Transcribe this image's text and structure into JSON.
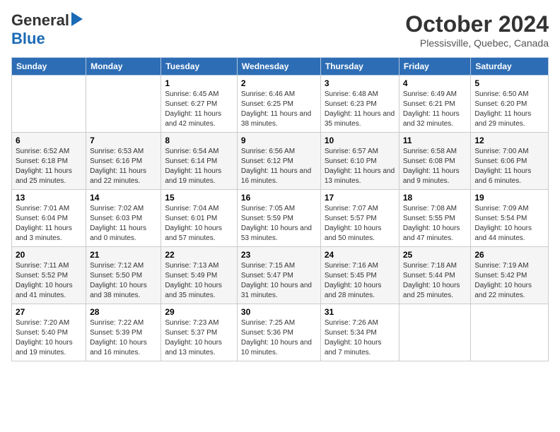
{
  "header": {
    "logo_line1": "General",
    "logo_line2": "Blue",
    "month_year": "October 2024",
    "location": "Plessisville, Quebec, Canada"
  },
  "calendar": {
    "days_of_week": [
      "Sunday",
      "Monday",
      "Tuesday",
      "Wednesday",
      "Thursday",
      "Friday",
      "Saturday"
    ],
    "weeks": [
      [
        {
          "day": "",
          "info": ""
        },
        {
          "day": "",
          "info": ""
        },
        {
          "day": "1",
          "info": "Sunrise: 6:45 AM\nSunset: 6:27 PM\nDaylight: 11 hours and 42 minutes."
        },
        {
          "day": "2",
          "info": "Sunrise: 6:46 AM\nSunset: 6:25 PM\nDaylight: 11 hours and 38 minutes."
        },
        {
          "day": "3",
          "info": "Sunrise: 6:48 AM\nSunset: 6:23 PM\nDaylight: 11 hours and 35 minutes."
        },
        {
          "day": "4",
          "info": "Sunrise: 6:49 AM\nSunset: 6:21 PM\nDaylight: 11 hours and 32 minutes."
        },
        {
          "day": "5",
          "info": "Sunrise: 6:50 AM\nSunset: 6:20 PM\nDaylight: 11 hours and 29 minutes."
        }
      ],
      [
        {
          "day": "6",
          "info": "Sunrise: 6:52 AM\nSunset: 6:18 PM\nDaylight: 11 hours and 25 minutes."
        },
        {
          "day": "7",
          "info": "Sunrise: 6:53 AM\nSunset: 6:16 PM\nDaylight: 11 hours and 22 minutes."
        },
        {
          "day": "8",
          "info": "Sunrise: 6:54 AM\nSunset: 6:14 PM\nDaylight: 11 hours and 19 minutes."
        },
        {
          "day": "9",
          "info": "Sunrise: 6:56 AM\nSunset: 6:12 PM\nDaylight: 11 hours and 16 minutes."
        },
        {
          "day": "10",
          "info": "Sunrise: 6:57 AM\nSunset: 6:10 PM\nDaylight: 11 hours and 13 minutes."
        },
        {
          "day": "11",
          "info": "Sunrise: 6:58 AM\nSunset: 6:08 PM\nDaylight: 11 hours and 9 minutes."
        },
        {
          "day": "12",
          "info": "Sunrise: 7:00 AM\nSunset: 6:06 PM\nDaylight: 11 hours and 6 minutes."
        }
      ],
      [
        {
          "day": "13",
          "info": "Sunrise: 7:01 AM\nSunset: 6:04 PM\nDaylight: 11 hours and 3 minutes."
        },
        {
          "day": "14",
          "info": "Sunrise: 7:02 AM\nSunset: 6:03 PM\nDaylight: 11 hours and 0 minutes."
        },
        {
          "day": "15",
          "info": "Sunrise: 7:04 AM\nSunset: 6:01 PM\nDaylight: 10 hours and 57 minutes."
        },
        {
          "day": "16",
          "info": "Sunrise: 7:05 AM\nSunset: 5:59 PM\nDaylight: 10 hours and 53 minutes."
        },
        {
          "day": "17",
          "info": "Sunrise: 7:07 AM\nSunset: 5:57 PM\nDaylight: 10 hours and 50 minutes."
        },
        {
          "day": "18",
          "info": "Sunrise: 7:08 AM\nSunset: 5:55 PM\nDaylight: 10 hours and 47 minutes."
        },
        {
          "day": "19",
          "info": "Sunrise: 7:09 AM\nSunset: 5:54 PM\nDaylight: 10 hours and 44 minutes."
        }
      ],
      [
        {
          "day": "20",
          "info": "Sunrise: 7:11 AM\nSunset: 5:52 PM\nDaylight: 10 hours and 41 minutes."
        },
        {
          "day": "21",
          "info": "Sunrise: 7:12 AM\nSunset: 5:50 PM\nDaylight: 10 hours and 38 minutes."
        },
        {
          "day": "22",
          "info": "Sunrise: 7:13 AM\nSunset: 5:49 PM\nDaylight: 10 hours and 35 minutes."
        },
        {
          "day": "23",
          "info": "Sunrise: 7:15 AM\nSunset: 5:47 PM\nDaylight: 10 hours and 31 minutes."
        },
        {
          "day": "24",
          "info": "Sunrise: 7:16 AM\nSunset: 5:45 PM\nDaylight: 10 hours and 28 minutes."
        },
        {
          "day": "25",
          "info": "Sunrise: 7:18 AM\nSunset: 5:44 PM\nDaylight: 10 hours and 25 minutes."
        },
        {
          "day": "26",
          "info": "Sunrise: 7:19 AM\nSunset: 5:42 PM\nDaylight: 10 hours and 22 minutes."
        }
      ],
      [
        {
          "day": "27",
          "info": "Sunrise: 7:20 AM\nSunset: 5:40 PM\nDaylight: 10 hours and 19 minutes."
        },
        {
          "day": "28",
          "info": "Sunrise: 7:22 AM\nSunset: 5:39 PM\nDaylight: 10 hours and 16 minutes."
        },
        {
          "day": "29",
          "info": "Sunrise: 7:23 AM\nSunset: 5:37 PM\nDaylight: 10 hours and 13 minutes."
        },
        {
          "day": "30",
          "info": "Sunrise: 7:25 AM\nSunset: 5:36 PM\nDaylight: 10 hours and 10 minutes."
        },
        {
          "day": "31",
          "info": "Sunrise: 7:26 AM\nSunset: 5:34 PM\nDaylight: 10 hours and 7 minutes."
        },
        {
          "day": "",
          "info": ""
        },
        {
          "day": "",
          "info": ""
        }
      ]
    ]
  }
}
